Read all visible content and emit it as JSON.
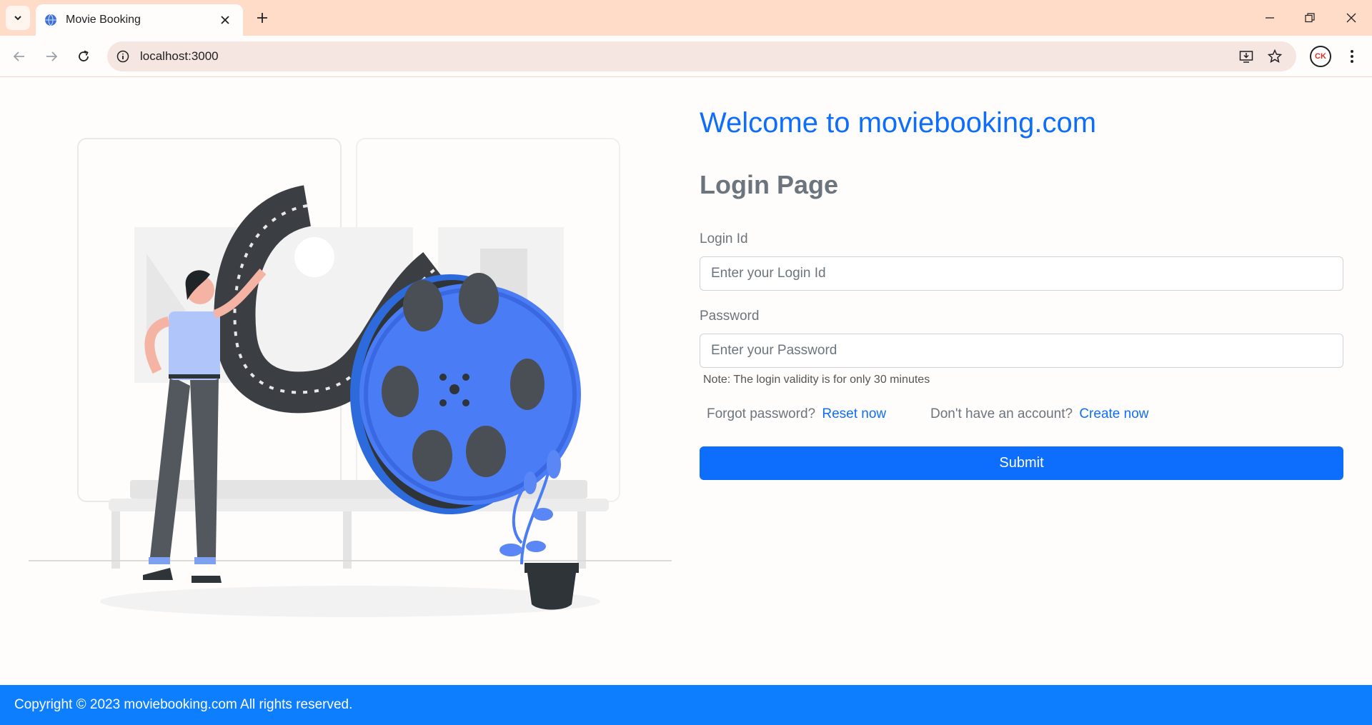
{
  "browser": {
    "tab_title": "Movie Booking",
    "url": "localhost:3000",
    "profile_initials": "CK"
  },
  "page": {
    "welcome": "Welcome to moviebooking.com",
    "title": "Login Page",
    "login_id": {
      "label": "Login Id",
      "placeholder": "Enter your Login Id",
      "value": ""
    },
    "password": {
      "label": "Password",
      "placeholder": "Enter your Password",
      "value": ""
    },
    "note": "Note: The login validity is for only 30 minutes",
    "forgot_text": "Forgot password?",
    "reset_link": "Reset now",
    "no_account_text": "Don't have an account?",
    "create_link": "Create now",
    "submit_label": "Submit"
  },
  "footer": {
    "copyright": "Copyright © 2023 moviebooking.com All rights reserved."
  },
  "colors": {
    "accent": "#0d6efd",
    "tabbar": "#ffdcc8",
    "illustration_blue": "#4a7cf6",
    "illustration_dark": "#3b3f43"
  }
}
